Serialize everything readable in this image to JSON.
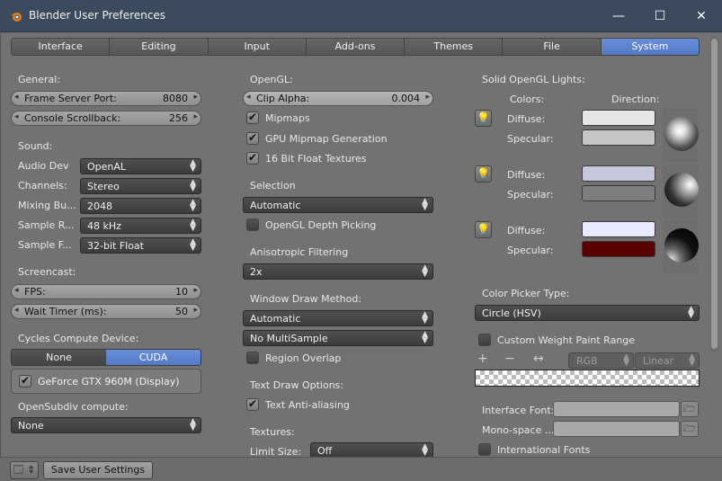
{
  "window": {
    "title": "Blender User Preferences",
    "minimize": "—",
    "maximize": "☐",
    "close": "✕"
  },
  "tabs": [
    "Interface",
    "Editing",
    "Input",
    "Add-ons",
    "Themes",
    "File",
    "System"
  ],
  "active_tab": "System",
  "general": {
    "heading": "General:",
    "frame_server_port": {
      "label": "Frame Server Port:",
      "value": "8080"
    },
    "console_scrollback": {
      "label": "Console Scrollback:",
      "value": "256"
    }
  },
  "sound": {
    "heading": "Sound:",
    "rows": [
      {
        "label": "Audio Dev",
        "value": "OpenAL"
      },
      {
        "label": "Channels:",
        "value": "Stereo"
      },
      {
        "label": "Mixing Bu...",
        "value": "2048"
      },
      {
        "label": "Sample R...",
        "value": "48 kHz"
      },
      {
        "label": "Sample F...",
        "value": "32-bit Float"
      }
    ]
  },
  "screencast": {
    "heading": "Screencast:",
    "fps": {
      "label": "FPS:",
      "value": "10"
    },
    "wait_timer": {
      "label": "Wait Timer (ms):",
      "value": "50"
    }
  },
  "cycles": {
    "heading": "Cycles Compute Device:",
    "options": [
      "None",
      "CUDA"
    ],
    "selected": "CUDA",
    "gpu_label": "GeForce GTX 960M (Display)",
    "gpu_checked": true
  },
  "opensubdiv": {
    "heading": "OpenSubdiv compute:",
    "value": "None"
  },
  "opengl": {
    "heading": "OpenGL:",
    "clip_alpha": {
      "label": "Clip Alpha:",
      "value": "0.004"
    },
    "checks": [
      {
        "label": "Mipmaps",
        "checked": true
      },
      {
        "label": "GPU Mipmap Generation",
        "checked": true
      },
      {
        "label": "16 Bit Float Textures",
        "checked": true
      }
    ]
  },
  "selection": {
    "heading": "Selection",
    "value": "Automatic",
    "depth_picking": "OpenGL Depth Picking",
    "depth_checked": false
  },
  "anisotropic": {
    "heading": "Anisotropic Filtering",
    "value": "2x"
  },
  "window_draw": {
    "heading": "Window Draw Method:",
    "method": "Automatic",
    "multisample": "No MultiSample",
    "region_overlap": "Region Overlap",
    "region_checked": false
  },
  "text_draw": {
    "heading": "Text Draw Options:",
    "anti_aliasing": "Text Anti-aliasing",
    "aa_checked": true
  },
  "textures": {
    "heading": "Textures:",
    "limit_label": "Limit Size:",
    "limit_value": "Off"
  },
  "lights": {
    "heading": "Solid OpenGL Lights:",
    "colors_label": "Colors:",
    "direction_label": "Direction:",
    "diffuse_label": "Diffuse:",
    "specular_label": "Specular:",
    "items": [
      {
        "diffuse": "#e6e6e6",
        "specular": "#c6c6c6"
      },
      {
        "diffuse": "#c5c8dc",
        "specular": "#7e7e7e"
      },
      {
        "diffuse": "#e8eaff",
        "specular": "#5a0000"
      }
    ]
  },
  "color_picker": {
    "heading": "Color Picker Type:",
    "value": "Circle (HSV)"
  },
  "weight_paint": {
    "label": "Custom Weight Paint Range",
    "checked": false,
    "mode": "RGB",
    "interp": "Linear"
  },
  "fonts": {
    "interface_label": "Interface Font:",
    "mono_label": "Mono-space ...",
    "international": "International Fonts"
  },
  "footer": {
    "save_label": "Save User Settings"
  },
  "colors": {
    "accent": "#5b82cf",
    "panel": "#727272",
    "titlebar": "#3b4a5c"
  }
}
